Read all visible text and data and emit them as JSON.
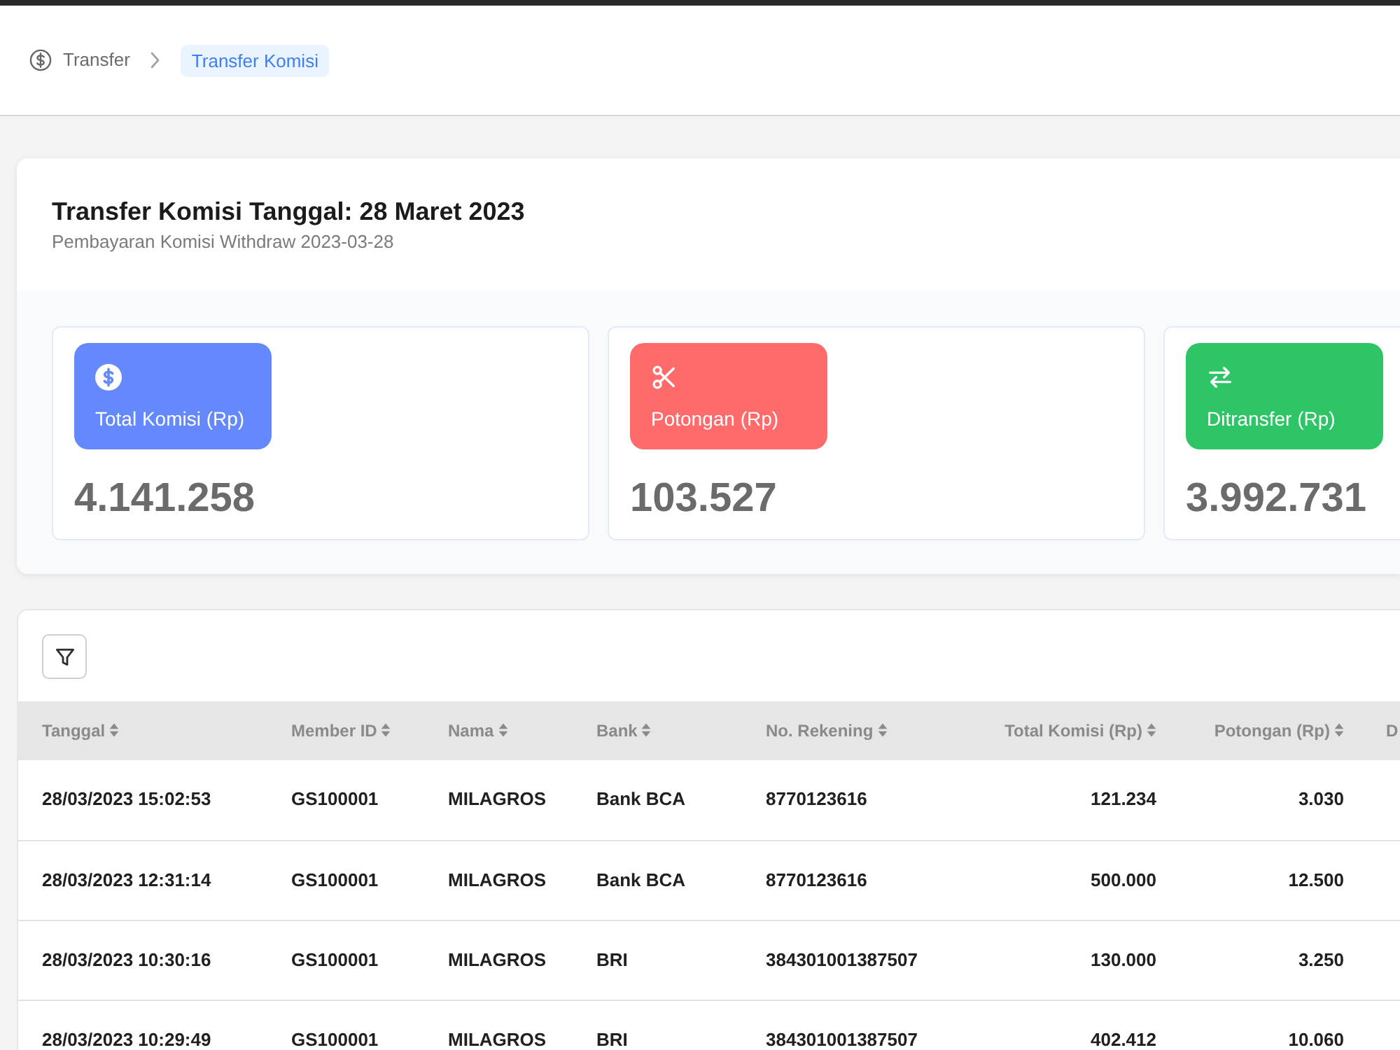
{
  "breadcrumb": [
    {
      "label": "Transfer",
      "selected": false
    },
    {
      "label": "Transfer Komisi",
      "selected": true
    }
  ],
  "summary": {
    "title": "Transfer Komisi Tanggal: 28 Maret 2023",
    "subtitle": "Pembayaran Komisi Withdraw 2023-03-28",
    "stats": [
      {
        "kind": "commission",
        "label": "Total Komisi (Rp)",
        "value": "4.141.258",
        "color": "#6389fc"
      },
      {
        "kind": "deduction",
        "label": "Potongan (Rp)",
        "value": "103.527",
        "color": "#ff6b6b"
      },
      {
        "kind": "transfer",
        "label": "Ditransfer (Rp)",
        "value": "3.992.731",
        "color": "#2dc566"
      }
    ]
  },
  "table": {
    "columns": [
      {
        "label": "Tanggal",
        "kind": "text",
        "sortable": true
      },
      {
        "label": "Member ID",
        "kind": "text",
        "sortable": true
      },
      {
        "label": "Nama",
        "kind": "text",
        "sortable": true
      },
      {
        "label": "Bank",
        "kind": "text",
        "sortable": true
      },
      {
        "label": "No. Rekening",
        "kind": "text",
        "sortable": true
      },
      {
        "label": "Total Komisi (Rp)",
        "kind": "amount",
        "sortable": true
      },
      {
        "label": "Potongan (Rp)",
        "kind": "amount",
        "sortable": true
      },
      {
        "label": "D",
        "kind": "text"
      }
    ],
    "rows": [
      [
        "28/03/2023 15:02:53",
        "GS100001",
        "MILAGROS",
        "Bank BCA",
        "8770123616",
        "121.234",
        "3.030"
      ],
      [
        "28/03/2023 12:31:14",
        "GS100001",
        "MILAGROS",
        "Bank BCA",
        "8770123616",
        "500.000",
        "12.500"
      ],
      [
        "28/03/2023 10:30:16",
        "GS100001",
        "MILAGROS",
        "BRI",
        "384301001387507",
        "130.000",
        "3.250"
      ],
      [
        "28/03/2023 10:29:49",
        "GS100001",
        "MILAGROS",
        "BRI",
        "384301001387507",
        "402.412",
        "10.060"
      ]
    ]
  }
}
